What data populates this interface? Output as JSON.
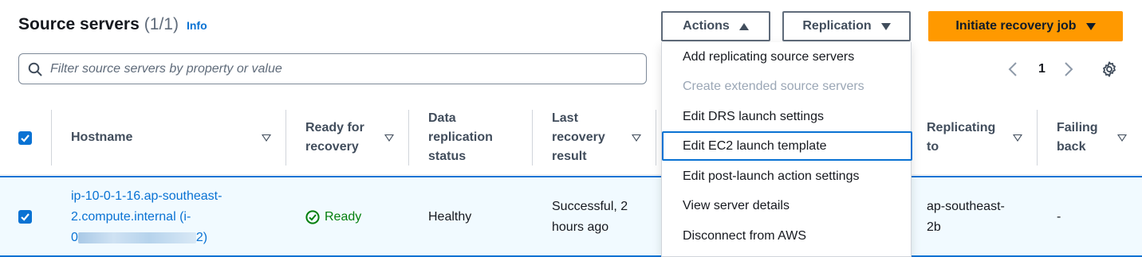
{
  "header": {
    "title": "Source servers",
    "count": "(1/1)",
    "info": "Info"
  },
  "buttons": {
    "actions": "Actions",
    "replication": "Replication",
    "initiate": "Initiate recovery job"
  },
  "filter": {
    "placeholder": "Filter source servers by property or value"
  },
  "pagination": {
    "current_page": "1"
  },
  "columns": [
    "Hostname",
    "Ready for\nrecovery",
    "Data\nreplication\nstatus",
    "Last\nrecovery\nresult",
    "Replicating\nto",
    "Failing\nback"
  ],
  "row": {
    "hostname_line1": "ip-10-0-1-16.ap-southeast-",
    "hostname_line2": "2.compute.internal (i-",
    "hostname_line3_start": "0",
    "hostname_line3_end": "2)",
    "ready": "Ready",
    "replication_status": "Healthy",
    "last_result": "Successful, 2\nhours ago",
    "replicating_to": "ap-southeast-\n2b",
    "failing_back": "-"
  },
  "menu": {
    "items": [
      "Add replicating source servers",
      "Create extended source servers",
      "Edit DRS launch settings",
      "Edit EC2 launch template",
      "Edit post-launch action settings",
      "View server details",
      "Disconnect from AWS"
    ],
    "disabled_item": "Create extended source servers",
    "focused_item": "Edit EC2 launch template"
  },
  "colors": {
    "primary_orange": "#ff9900",
    "link_blue": "#0972d3",
    "success_green": "#037f0c",
    "selected_row_bg": "#f1faff"
  }
}
